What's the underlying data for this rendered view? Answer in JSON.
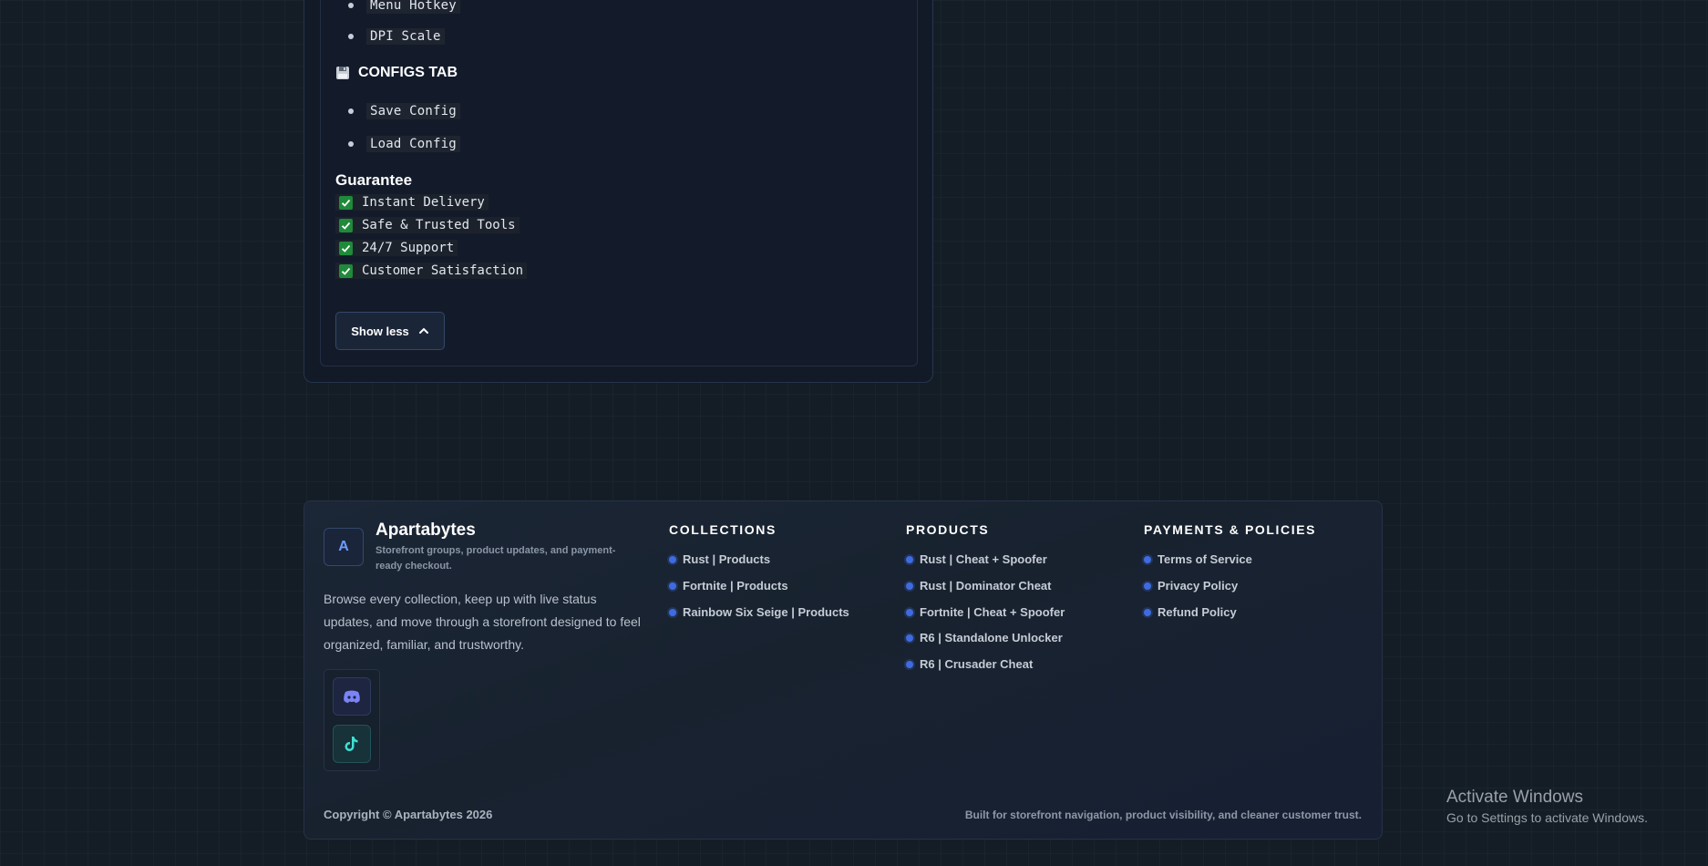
{
  "description": {
    "menu_items": [
      "Menu Hotkey",
      "DPI Scale"
    ],
    "configs_tab_title": "CONFIGS TAB",
    "configs_items": [
      "Save Config",
      "Load Config"
    ],
    "guarantee_title": "Guarantee",
    "guarantee_items": [
      "Instant Delivery",
      "Safe & Trusted Tools",
      "24/7 Support",
      "Customer Satisfaction"
    ],
    "show_less_label": "Show less"
  },
  "footer": {
    "brand_initial": "A",
    "brand_name": "Apartabytes",
    "brand_tagline": "Storefront groups, product updates, and payment-ready checkout.",
    "brand_description": "Browse every collection, keep up with live status updates, and move through a storefront designed to feel organized, familiar, and trustworthy.",
    "social": [
      "discord-icon",
      "tiktok-icon"
    ],
    "collections": {
      "title": "COLLECTIONS",
      "links": [
        "Rust | Products",
        "Fortnite | Products",
        "Rainbow Six Seige | Products"
      ]
    },
    "products": {
      "title": "PRODUCTS",
      "links": [
        "Rust | Cheat + Spoofer",
        "Rust | Dominator Cheat",
        "Fortnite | Cheat + Spoofer",
        "R6 | Standalone Unlocker",
        "R6 | Crusader Cheat"
      ]
    },
    "policies": {
      "title": "PAYMENTS & POLICIES",
      "links": [
        "Terms of Service",
        "Privacy Policy",
        "Refund Policy"
      ]
    },
    "copyright": "Copyright © Apartabytes 2026",
    "built_text": "Built for storefront navigation, product visibility, and cleaner customer trust."
  },
  "watermark": {
    "title": "Activate Windows",
    "subtitle": "Go to Settings to activate Windows."
  },
  "colors": {
    "accent": "#3f6be0",
    "check_green": "#1f8a3a",
    "discord": "#7b84f5",
    "tiktok": "#3fe0d6"
  }
}
